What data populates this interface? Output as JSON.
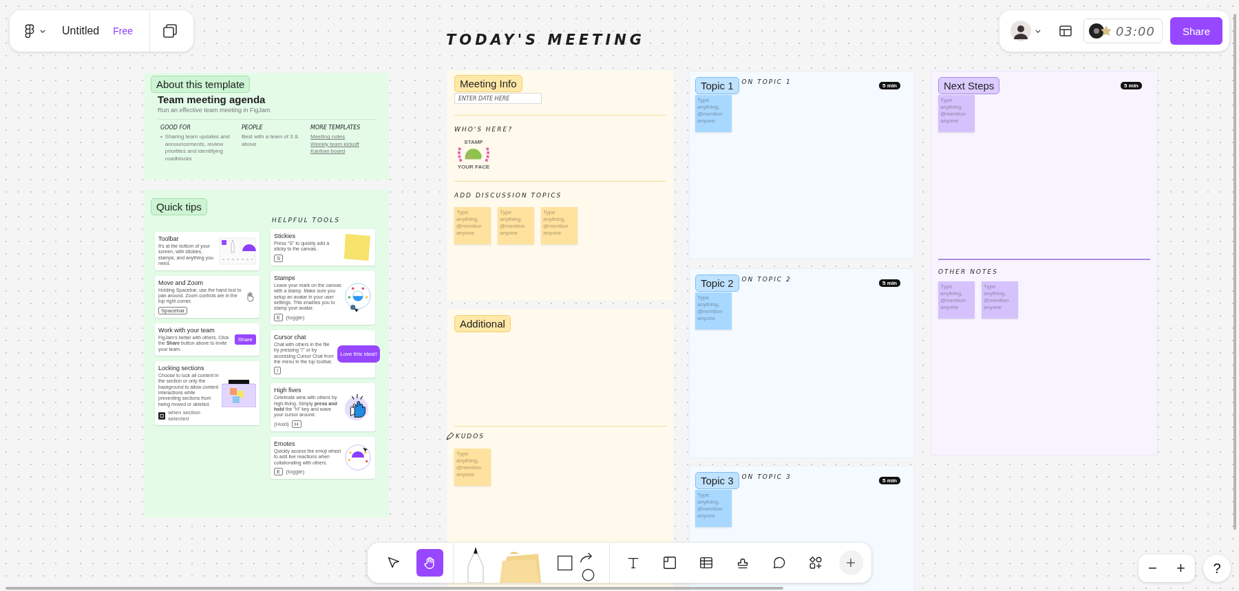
{
  "file_bar": {
    "file_name": "Untitled",
    "plan": "Free"
  },
  "board_title": "TODAY'S MEETING",
  "session_bar": {
    "timer": "03:00",
    "share": "Share"
  },
  "about": {
    "label": "About this template",
    "title": "Team meeting agenda",
    "subtitle": "Run an effective team meeting in FigJam",
    "good_for": {
      "heading": "GOOD FOR",
      "marker": "•",
      "bullets": [
        "Sharing team updates and announcements, review priorities and identifying roadblocks"
      ]
    },
    "people": {
      "heading": "PEOPLE",
      "text": "Best with a team of 3 & above"
    },
    "more_templates": {
      "heading": "MORE TEMPLATES",
      "links": [
        "Meeting notes",
        "Weekly team kickoff",
        "Kanban board"
      ]
    }
  },
  "quick_tips": {
    "label": "Quick tips",
    "tools_heading": "HELPFUL TOOLS",
    "tips": [
      {
        "title": "Toolbar",
        "body": "It's at the bottom of your screen, with stickies, stamps, and anything you need.",
        "kind": "toolbar"
      },
      {
        "title": "Move and Zoom",
        "body": "Holding Spacebar, use the hand tool to pan around. Zoom controls are in the top right corner.",
        "kind": "hand",
        "shortcut": [
          {
            "kind": "key",
            "text": "Spacebar"
          }
        ]
      },
      {
        "title": "Work with your team",
        "body": "FigJam's better with others. Click the **Share** button above to invite your team.",
        "kind": "share",
        "button": "Share"
      },
      {
        "title": "Locking sections",
        "body": "Choose to lock all content in the section or only the background to allow content interactions while preventing sections from being moved or deleted.",
        "kind": "lock",
        "shortcut": [
          {
            "kind": "lock"
          },
          {
            "kind": "note",
            "text": "when section selected"
          }
        ]
      }
    ],
    "tools": [
      {
        "title": "Stickies",
        "body": "Press \"S\" to quickly add a sticky to the canvas.",
        "kind": "sticky",
        "shortcut": [
          {
            "kind": "key",
            "text": "S"
          }
        ]
      },
      {
        "title": "Stamps",
        "body": "Leave your mark on the canvas with a stamp. Make sure you setup an avatar in your user settings. This enables you to stamp your avatar.",
        "kind": "stamps",
        "shortcut": [
          {
            "kind": "key",
            "text": "E"
          },
          {
            "kind": "note",
            "text": "(toggle)"
          }
        ]
      },
      {
        "title": "Cursor chat",
        "body": "Chat with others in the file by pressing \"/\" or by accessing Cursor Chat from the menu in the top toolbar.",
        "kind": "chat",
        "bubble": "Love this idea!!",
        "shortcut": [
          {
            "kind": "key",
            "text": "/"
          }
        ]
      },
      {
        "title": "High fives",
        "body": "Celebrate wins with others by high-fiving. Simply **press and hold** the \"H\" key and wave your cursor around.",
        "kind": "highfive",
        "shortcut": [
          {
            "kind": "note",
            "text": "(Hold)"
          },
          {
            "kind": "key",
            "text": "H"
          }
        ]
      },
      {
        "title": "Emotes",
        "body": "Quickly access the emoji wheel to add live reactions when collaborating with others.",
        "kind": "emotes",
        "shortcut": [
          {
            "kind": "key",
            "text": "E"
          },
          {
            "kind": "note",
            "text": "(toggle)"
          }
        ]
      }
    ]
  },
  "meeting_info": {
    "label": "Meeting Info",
    "date_placeholder": "ENTER DATE HERE",
    "whos_here": "WHO'S HERE?",
    "stamp_top": "STAMP",
    "stamp_bottom": "YOUR FACE",
    "topics_heading": "ADD DISCUSSION TOPICS",
    "stickies": [
      {
        "placeholder": "Type anything, @mention anyone"
      },
      {
        "placeholder": "Type anything, @mention anyone"
      },
      {
        "placeholder": "Type anything, @mention anyone"
      }
    ]
  },
  "additional": {
    "label": "Additional",
    "kudos_heading": "KUDOS",
    "stickies": [
      {
        "placeholder": "Type anything, @mention anyone"
      }
    ]
  },
  "topics": [
    {
      "label": "Topic 1",
      "heading": "ON TOPIC 1",
      "timer": "5 min",
      "stickies": [
        {
          "placeholder": "Type anything, @mention anyone"
        }
      ]
    },
    {
      "label": "Topic 2",
      "heading": "ON TOPIC 2",
      "timer": "5 min",
      "stickies": [
        {
          "placeholder": "Type anything, @mention anyone"
        }
      ]
    },
    {
      "label": "Topic 3",
      "heading": "ON TOPIC 3",
      "timer": "5 min",
      "stickies": [
        {
          "placeholder": "Type anything, @mention anyone"
        }
      ]
    }
  ],
  "next_steps": {
    "label": "Next Steps",
    "timer": "5 min",
    "stickies": [
      {
        "placeholder": "Type anything, @mention anyone"
      }
    ],
    "other_heading": "OTHER NOTES",
    "other_stickies": [
      {
        "placeholder": "Type anything, @mention anyone"
      },
      {
        "placeholder": "Type anything, @mention anyone"
      }
    ]
  },
  "toolbar": {
    "tools": [
      {
        "kind": "select",
        "selected": false
      },
      {
        "kind": "hand",
        "selected": true
      },
      {
        "kind": "pen",
        "selected": false
      },
      {
        "kind": "sticky",
        "selected": false
      },
      {
        "kind": "shapes",
        "selected": false
      },
      {
        "kind": "text",
        "selected": false
      },
      {
        "kind": "section",
        "selected": false
      },
      {
        "kind": "table",
        "selected": false
      },
      {
        "kind": "stamp",
        "selected": false
      },
      {
        "kind": "comment",
        "selected": false
      },
      {
        "kind": "widgets",
        "selected": false
      },
      {
        "kind": "plus",
        "selected": false
      }
    ]
  },
  "zoom_controls": {
    "zoom_out": "−",
    "zoom_in": "+"
  },
  "help": "?"
}
